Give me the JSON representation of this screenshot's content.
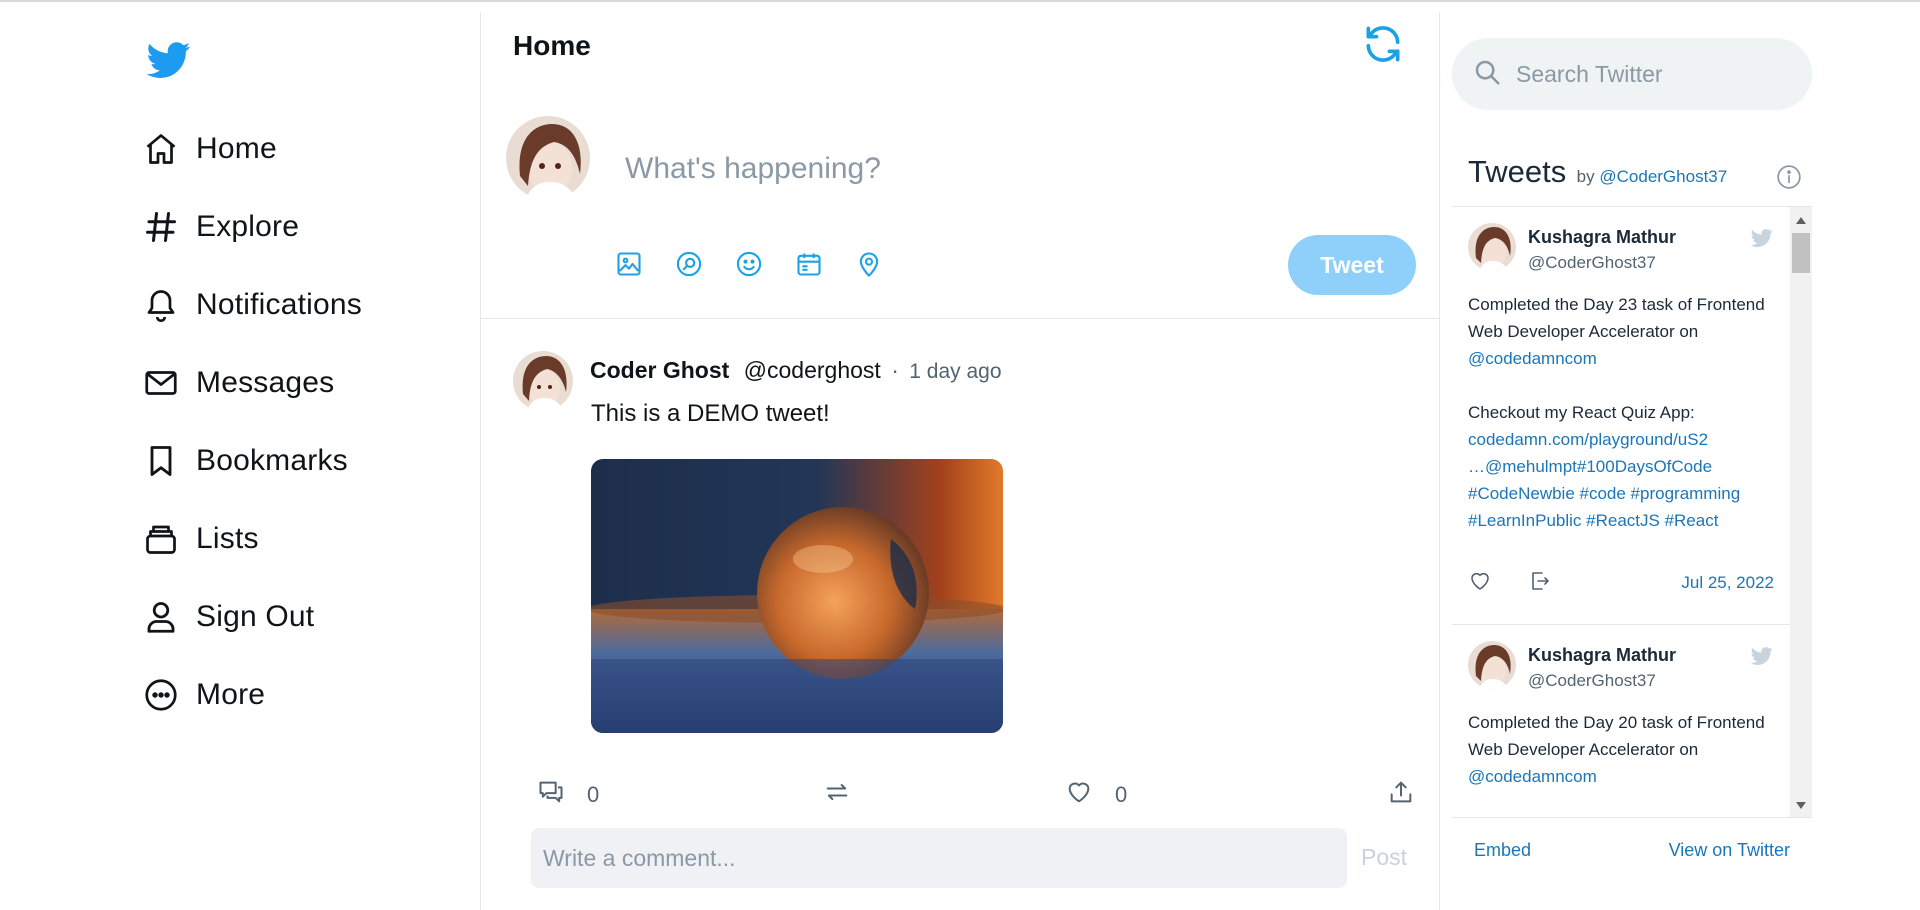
{
  "colors": {
    "brand": "#1d9bf0",
    "accent_icon": "#1ba1e6",
    "tweet_button_disabled": "#8ed0f9",
    "link": "#1b76b8"
  },
  "sidebar": {
    "logo_icon": "twitter-bird-icon",
    "items": [
      {
        "label": "Home",
        "icon": "home-icon"
      },
      {
        "label": "Explore",
        "icon": "hashtag-icon"
      },
      {
        "label": "Notifications",
        "icon": "bell-icon"
      },
      {
        "label": "Messages",
        "icon": "mail-icon"
      },
      {
        "label": "Bookmarks",
        "icon": "bookmark-icon"
      },
      {
        "label": "Lists",
        "icon": "lists-icon"
      },
      {
        "label": "Sign Out",
        "icon": "user-icon"
      },
      {
        "label": "More",
        "icon": "more-circle-icon"
      }
    ]
  },
  "header": {
    "title": "Home",
    "refresh_icon": "refresh-icon"
  },
  "composer": {
    "placeholder": "What's happening?",
    "tools": [
      "image-icon",
      "gif-search-icon",
      "emoji-icon",
      "schedule-icon",
      "location-icon"
    ],
    "tweet_label": "Tweet"
  },
  "post": {
    "name": "Coder Ghost",
    "handle": "@coderghost",
    "separator": "·",
    "time": "1 day ago",
    "text": "This is a DEMO tweet!",
    "comments": "0",
    "likes": "0",
    "comment_placeholder": "Write a comment...",
    "post_label": "Post"
  },
  "search": {
    "placeholder": "Search Twitter"
  },
  "embed": {
    "title": "Tweets",
    "by": "by",
    "by_handle": "@CoderGhost37",
    "tweets": [
      {
        "name": "Kushagra Mathur",
        "handle": "@CoderGhost37",
        "line1": "Completed the Day 23 task of Frontend Web Developer Accelerator on",
        "mention": "@codedamncom",
        "line2": "Checkout my React Quiz App:",
        "link1": "codedamn.com/playground/uS2",
        "link2": "…@mehulmpt#100DaysOfCode",
        "link3": "#CodeNewbie #code #programming",
        "link4": "#LearnInPublic #ReactJS #React",
        "date": "Jul 25, 2022"
      },
      {
        "name": "Kushagra Mathur",
        "handle": "@CoderGhost37",
        "line1": "Completed the Day 20 task of Frontend Web Developer Accelerator on",
        "mention": "@codedamncom"
      }
    ],
    "embed_label": "Embed",
    "view_label": "View on Twitter"
  }
}
